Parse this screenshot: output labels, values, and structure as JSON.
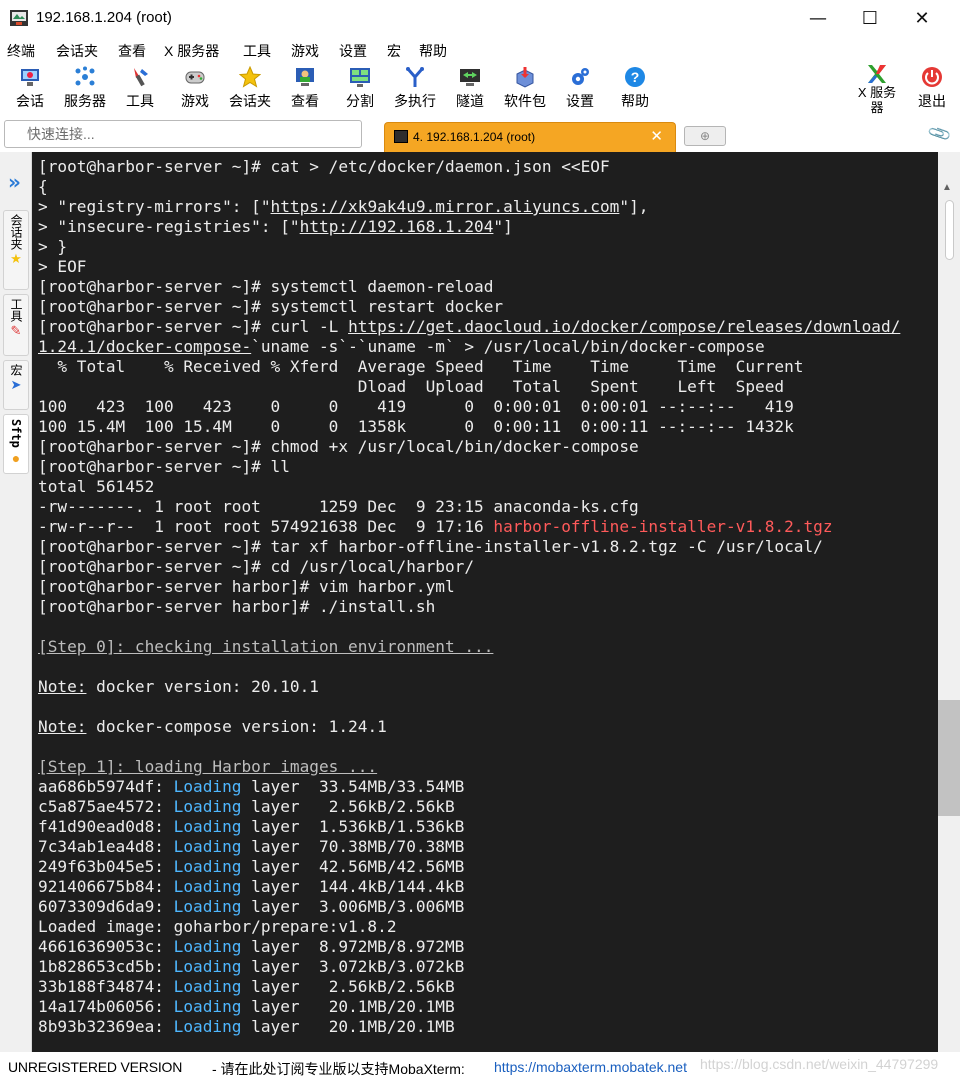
{
  "window": {
    "title": "192.168.1.204 (root)",
    "minimize": "—",
    "maximize": "☐",
    "close": "✕"
  },
  "menu": [
    "终端",
    "会话夹",
    "查看",
    "X 服务器",
    "工具",
    "游戏",
    "设置",
    "宏",
    "帮助"
  ],
  "toolbar": {
    "items": [
      {
        "label": "会话",
        "icon": "monitor-icon"
      },
      {
        "label": "服务器",
        "icon": "network-icon"
      },
      {
        "label": "工具",
        "icon": "tools-icon"
      },
      {
        "label": "游戏",
        "icon": "gamepad-icon"
      },
      {
        "label": "会话夹",
        "icon": "star-icon"
      },
      {
        "label": "查看",
        "icon": "user-view-icon"
      },
      {
        "label": "分割",
        "icon": "split-icon"
      },
      {
        "label": "多执行",
        "icon": "fork-icon"
      },
      {
        "label": "隧道",
        "icon": "tunnel-icon"
      },
      {
        "label": "软件包",
        "icon": "package-icon"
      },
      {
        "label": "设置",
        "icon": "gear-icon"
      },
      {
        "label": "帮助",
        "icon": "help-icon"
      }
    ],
    "xserver_label_1": "X 服务",
    "xserver_label_2": "器",
    "exit_label": "退出"
  },
  "quick_connect": {
    "placeholder": "快速连接..."
  },
  "tabs": {
    "active_label": "4. 192.168.1.204 (root)",
    "close": "✕",
    "new_tab": "⊕"
  },
  "sidebar": {
    "tabs": [
      "会话夹",
      "工具",
      "宏",
      "Sftp"
    ]
  },
  "terminal": {
    "lines": [
      [
        {
          "t": "[root@harbor-server ~]# cat > /etc/docker/daemon.json <<EOF"
        }
      ],
      [
        {
          "t": "{"
        }
      ],
      [
        {
          "t": "> \"registry-mirrors\": [\""
        },
        {
          "t": "https://xk9ak4u9.mirror.aliyuncs.com",
          "c": "u"
        },
        {
          "t": "\"],"
        }
      ],
      [
        {
          "t": "> \"insecure-registries\": [\""
        },
        {
          "t": "http://192.168.1.204",
          "c": "u"
        },
        {
          "t": "\"]"
        }
      ],
      [
        {
          "t": "> }"
        }
      ],
      [
        {
          "t": "> EOF"
        }
      ],
      [
        {
          "t": "[root@harbor-server ~]# systemctl daemon-reload"
        }
      ],
      [
        {
          "t": "[root@harbor-server ~]# systemctl restart docker"
        }
      ],
      [
        {
          "t": "[root@harbor-server ~]# curl -L "
        },
        {
          "t": "https://get.daocloud.io/docker/compose/releases/download/",
          "c": "u"
        }
      ],
      [
        {
          "t": "1.24.1/docker-compose-",
          "c": "u"
        },
        {
          "t": "`uname -s`-`uname -m` > /usr/local/bin/docker-compose"
        }
      ],
      [
        {
          "t": "  % Total    % Received % Xferd  Average Speed   Time    Time     Time  Current"
        }
      ],
      [
        {
          "t": "                                 Dload  Upload   Total   Spent    Left  Speed"
        }
      ],
      [
        {
          "t": "100   423  100   423    0     0    419      0  0:00:01  0:00:01 --:--:--   419"
        }
      ],
      [
        {
          "t": "100 15.4M  100 15.4M    0     0  1358k      0  0:00:11  0:00:11 --:--:-- 1432k"
        }
      ],
      [
        {
          "t": "[root@harbor-server ~]# chmod +x /usr/local/bin/docker-compose"
        }
      ],
      [
        {
          "t": "[root@harbor-server ~]# ll"
        }
      ],
      [
        {
          "t": "total 561452"
        }
      ],
      [
        {
          "t": "-rw-------. 1 root root      1259 Dec  9 23:15 anaconda-ks.cfg"
        }
      ],
      [
        {
          "t": "-rw-r--r--  1 root root 574921638 Dec  9 17:16 "
        },
        {
          "t": "harbor-offline-installer-v1.8.2.tgz",
          "c": "red"
        }
      ],
      [
        {
          "t": "[root@harbor-server ~]# tar xf harbor-offline-installer-v1.8.2.tgz -C /usr/local/"
        }
      ],
      [
        {
          "t": "[root@harbor-server ~]# cd /usr/local/harbor/"
        }
      ],
      [
        {
          "t": "[root@harbor-server harbor]# vim harbor.yml"
        }
      ],
      [
        {
          "t": "[root@harbor-server harbor]# ./install.sh"
        }
      ],
      [
        {
          "t": ""
        }
      ],
      [
        {
          "t": "[Step 0]: checking installation environment ...",
          "c": "u dim"
        }
      ],
      [
        {
          "t": ""
        }
      ],
      [
        {
          "t": "Note:",
          "c": "u"
        },
        {
          "t": " docker version: 20.10.1"
        }
      ],
      [
        {
          "t": ""
        }
      ],
      [
        {
          "t": "Note:",
          "c": "u"
        },
        {
          "t": " docker-compose version: 1.24.1"
        }
      ],
      [
        {
          "t": ""
        }
      ],
      [
        {
          "t": "[Step 1]: loading Harbor images ...",
          "c": "u dim"
        }
      ],
      [
        {
          "t": "aa686b5974df: "
        },
        {
          "t": "Loading",
          "c": "cyan"
        },
        {
          "t": " layer  33.54MB/33.54MB"
        }
      ],
      [
        {
          "t": "c5a875ae4572: "
        },
        {
          "t": "Loading",
          "c": "cyan"
        },
        {
          "t": " layer   2.56kB/2.56kB"
        }
      ],
      [
        {
          "t": "f41d90ead0d8: "
        },
        {
          "t": "Loading",
          "c": "cyan"
        },
        {
          "t": " layer  1.536kB/1.536kB"
        }
      ],
      [
        {
          "t": "7c34ab1ea4d8: "
        },
        {
          "t": "Loading",
          "c": "cyan"
        },
        {
          "t": " layer  70.38MB/70.38MB"
        }
      ],
      [
        {
          "t": "249f63b045e5: "
        },
        {
          "t": "Loading",
          "c": "cyan"
        },
        {
          "t": " layer  42.56MB/42.56MB"
        }
      ],
      [
        {
          "t": "921406675b84: "
        },
        {
          "t": "Loading",
          "c": "cyan"
        },
        {
          "t": " layer  144.4kB/144.4kB"
        }
      ],
      [
        {
          "t": "6073309d6da9: "
        },
        {
          "t": "Loading",
          "c": "cyan"
        },
        {
          "t": " layer  3.006MB/3.006MB"
        }
      ],
      [
        {
          "t": "Loaded image: goharbor/prepare:v1.8.2"
        }
      ],
      [
        {
          "t": "46616369053c: "
        },
        {
          "t": "Loading",
          "c": "cyan"
        },
        {
          "t": " layer  8.972MB/8.972MB"
        }
      ],
      [
        {
          "t": "1b828653cd5b: "
        },
        {
          "t": "Loading",
          "c": "cyan"
        },
        {
          "t": " layer  3.072kB/3.072kB"
        }
      ],
      [
        {
          "t": "33b188f34874: "
        },
        {
          "t": "Loading",
          "c": "cyan"
        },
        {
          "t": " layer   2.56kB/2.56kB"
        }
      ],
      [
        {
          "t": "14a174b06056: "
        },
        {
          "t": "Loading",
          "c": "cyan"
        },
        {
          "t": " layer   20.1MB/20.1MB"
        }
      ],
      [
        {
          "t": "8b93b32369ea: "
        },
        {
          "t": "Loading",
          "c": "cyan"
        },
        {
          "t": " layer   20.1MB/20.1MB"
        }
      ]
    ]
  },
  "status": {
    "unregistered": "UNREGISTERED VERSION",
    "message": " -  请在此处订阅专业版以支持MobaXterm:",
    "link": "https://mobaxterm.mobatek.net",
    "watermark": "https://blog.csdn.net/weixin_44797299"
  },
  "colors": {
    "terminal_bg": "#1e1e1e",
    "tab_active": "#f5a623",
    "link": "#1a5fbf",
    "loading_text": "#4fb7ff",
    "archive_text": "#ff5a5a"
  }
}
